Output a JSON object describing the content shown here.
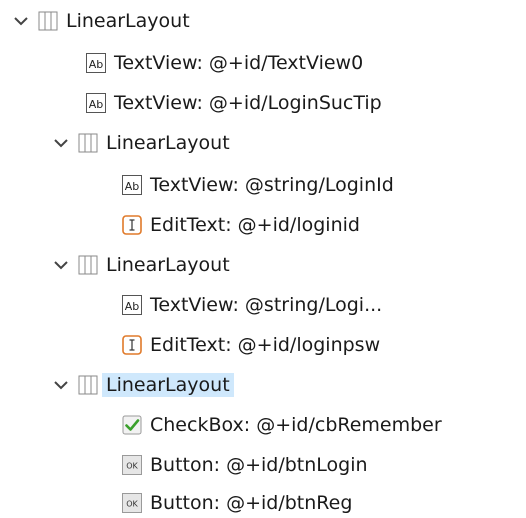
{
  "tree": {
    "root": {
      "label": "LinearLayout"
    },
    "items": [
      {
        "label": "TextView: @+id/TextView0"
      },
      {
        "label": "TextView: @+id/LoginSucTip"
      },
      {
        "label": "LinearLayout"
      },
      {
        "label": "TextView: @string/LoginId"
      },
      {
        "label": "EditText: @+id/loginid"
      },
      {
        "label": "LinearLayout"
      },
      {
        "label": "TextView: @string/Logi..."
      },
      {
        "label": "EditText: @+id/loginpsw"
      },
      {
        "label": "LinearLayout"
      },
      {
        "label": "CheckBox: @+id/cbRemember"
      },
      {
        "label": "Button: @+id/btnLogin"
      },
      {
        "label": "Button: @+id/btnReg"
      }
    ]
  },
  "colors": {
    "selection": "#cfe8fc",
    "edittext_icon": "#e07a2a",
    "checkbox_check": "#3aa02c"
  }
}
